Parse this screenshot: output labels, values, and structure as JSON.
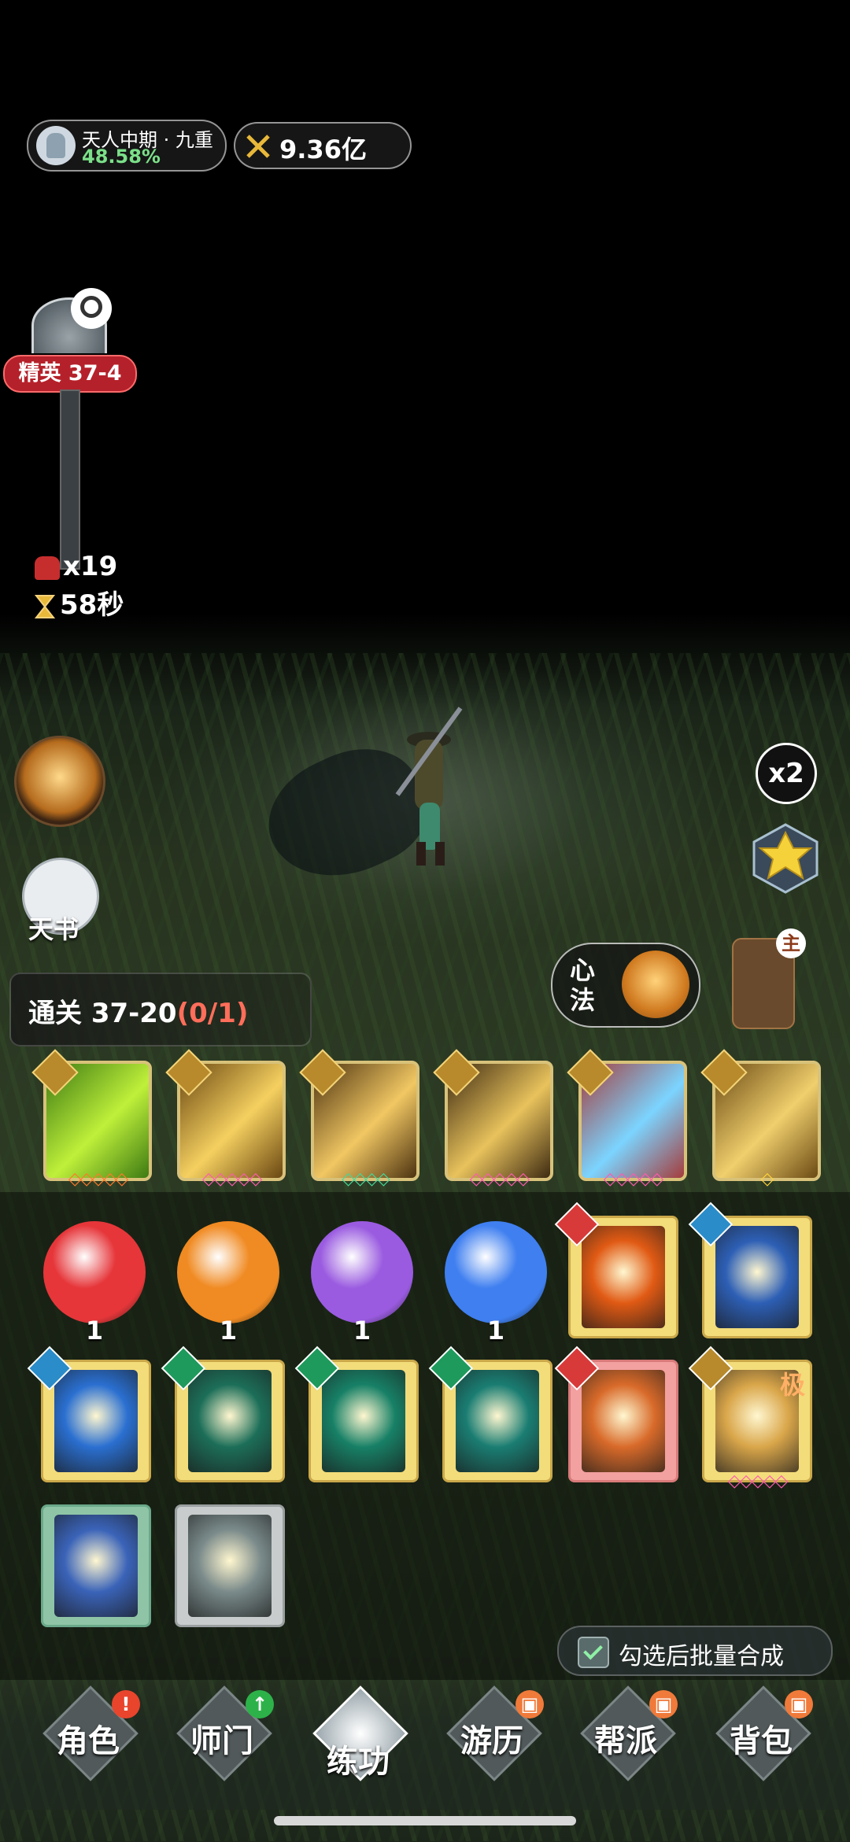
{
  "status": {
    "realm_name": "天人中期 · 九重",
    "realm_progress": "48.58%",
    "power": "9.36亿"
  },
  "stage": {
    "label": "精英 37-4",
    "enemy_count": "x19",
    "timer": "58秒"
  },
  "side": {
    "book_label": "天书",
    "speed_label": "x2",
    "heart_method_label": "心法",
    "main_badge": "主"
  },
  "quest": {
    "prefix": "通关 37-20",
    "progress": "(0/1)"
  },
  "skills": [
    {
      "name": "green-wind-skill",
      "color_a": "#3d7a13",
      "color_b": "#bff03a",
      "stars": "◇◇◇◇◇",
      "star_color": "#ff7a2a"
    },
    {
      "name": "golden-swords-skill",
      "color_a": "#6a4712",
      "color_b": "#f5d060",
      "stars": "◇◇◇◇◇",
      "star_color": "#ff5ab0"
    },
    {
      "name": "golden-strike-skill",
      "color_a": "#4c3210",
      "color_b": "#f1c763",
      "stars": "◇◇◇◇",
      "star_color": "#44d89a"
    },
    {
      "name": "golden-slash-skill",
      "color_a": "#3d2a12",
      "color_b": "#e8c25c",
      "stars": "◇◇◇◇◇",
      "star_color": "#ff5ab0"
    },
    {
      "name": "comet-skill",
      "color_a": "#a53b3b",
      "color_b": "#7bd4ff",
      "stars": "◇◇◇◇◇",
      "star_color": "#ff5ab0"
    },
    {
      "name": "golden-blade-skill",
      "color_a": "#6b4a14",
      "color_b": "#f0cf6d",
      "stars": "◇",
      "star_color": "#ffd23a"
    }
  ],
  "orbs": [
    {
      "name": "red-orb",
      "color": "#e6363a",
      "count": "1"
    },
    {
      "name": "orange-orb",
      "color": "#f08a22",
      "count": "1"
    },
    {
      "name": "purple-orb",
      "color": "#9a5be0",
      "count": "1"
    },
    {
      "name": "blue-orb",
      "color": "#3f7ff0",
      "count": "1"
    }
  ],
  "books": [
    {
      "name": "buddha-fire-book",
      "art": "#e05a14",
      "badge": "#d83a3a"
    },
    {
      "name": "taiji-book",
      "art": "#2d5fb5",
      "badge": "#2a8cc8"
    },
    {
      "name": "blue-lightning-book",
      "art": "#2a6fd0",
      "badge": "#2a8cc8"
    },
    {
      "name": "jade-palm-book",
      "art": "#1c6e58",
      "badge": "#1e9a5c"
    },
    {
      "name": "jade-claw-book",
      "art": "#178066",
      "badge": "#1e9a5c"
    },
    {
      "name": "jade-hand-book",
      "art": "#1a7d72",
      "badge": "#1e9a5c"
    },
    {
      "name": "fire-palms-book",
      "art": "#d86a2a",
      "badge": "#d83a3a"
    },
    {
      "name": "golden-blade-book",
      "art": "#d9a64a",
      "badge": "#b88a2b",
      "ji": "极",
      "stars": "◇◇◇◇◇"
    },
    {
      "name": "ice-wave-book",
      "art": "#3a63b8",
      "badge": ""
    },
    {
      "name": "silver-fang-book",
      "art": "#7a8a8a",
      "badge": ""
    }
  ],
  "batch": {
    "label": "勾选后批量合成"
  },
  "nav": [
    {
      "label": "角色",
      "badge": "!",
      "badge_color": "#e8452c"
    },
    {
      "label": "师门",
      "badge": "↑",
      "badge_color": "#2db24a"
    },
    {
      "label": "练功",
      "badge": "",
      "badge_color": ""
    },
    {
      "label": "游历",
      "badge": "▣",
      "badge_color": "#f07a3a"
    },
    {
      "label": "帮派",
      "badge": "▣",
      "badge_color": "#f07a3a"
    },
    {
      "label": "背包",
      "badge": "▣",
      "badge_color": "#f07a3a"
    }
  ]
}
